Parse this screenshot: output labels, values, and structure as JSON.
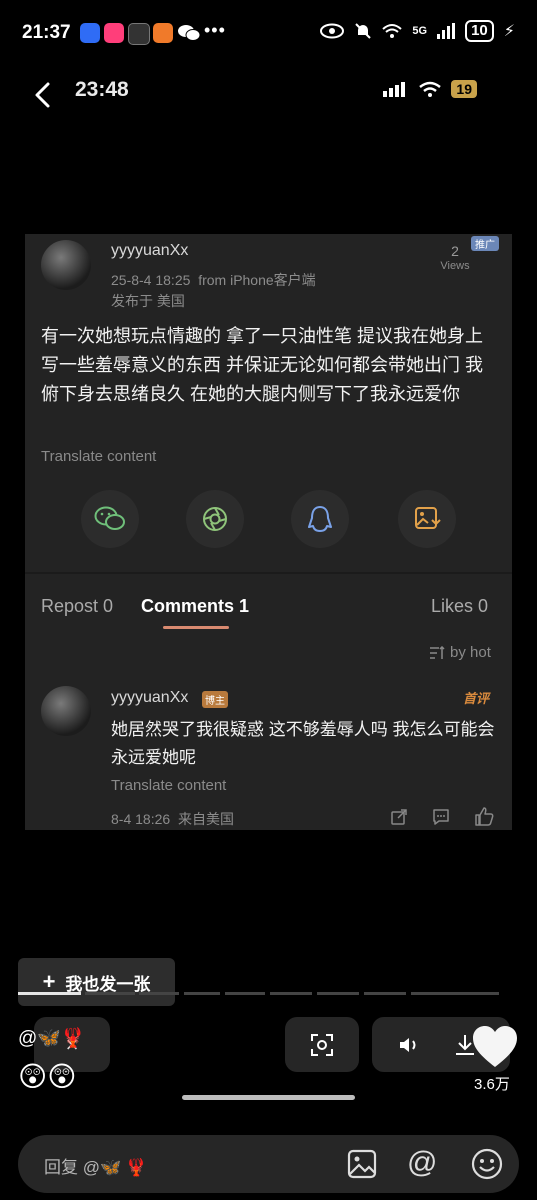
{
  "status_bar": {
    "time": "21:37",
    "dots": "•••",
    "network": "5G",
    "battery": "10"
  },
  "toolbar": {
    "time": "23:48",
    "battery": "19"
  },
  "post": {
    "username": "yyyyuanXx",
    "datetime": "25-8-4 18:25",
    "source": "from iPhone客户端",
    "location": "发布于 美国",
    "views_count": "2",
    "views_label": "Views",
    "promo_badge": "推广",
    "text": "有一次她想玩点情趣的 拿了一只油性笔 提议我在她身上写一些羞辱意义的东西 并保证无论如何都会带她出门 我俯下身去思绪良久 在她的大腿内侧写下了我永远爱你",
    "translate": "Translate content"
  },
  "tabs": {
    "repost": "Repost 0",
    "comments": "Comments 1",
    "likes": "Likes 0"
  },
  "sort": {
    "label": "by hot"
  },
  "comment": {
    "username": "yyyyuanXx",
    "author_badge": "博主",
    "first_badge": "首评",
    "text": "她居然哭了我很疑惑 这不够羞辱人吗 我怎么可能会永远爱她呢",
    "translate": "Translate content",
    "datetime": "8-4 18:26",
    "location": "来自美国"
  },
  "overlay": {
    "me_too_plus": "+",
    "me_too_label": "我也发一张",
    "mention_text": "@🦋🦞",
    "reactions": "😲😲",
    "likes_count": "3.6万"
  },
  "reply": {
    "placeholder": "回复 @🦋 🦞"
  },
  "progress": {
    "current_index": 1,
    "total": 9
  },
  "colors": {
    "background": "#000000",
    "card": "#232323",
    "accent_underline": "#d98a70",
    "badge_gold": "#c9a24a"
  }
}
